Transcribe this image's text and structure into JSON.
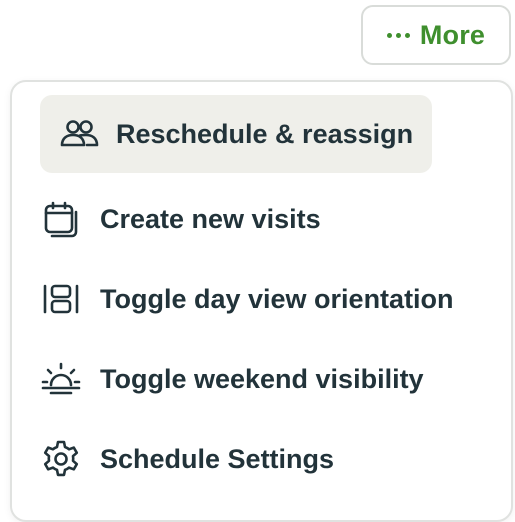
{
  "more_button": {
    "label": "More",
    "icon": "ellipsis-icon",
    "accent_color": "#3f8f2e"
  },
  "menu": {
    "items": [
      {
        "label": "Reschedule & reassign",
        "icon": "users-icon",
        "highlighted": true
      },
      {
        "label": "Create new visits",
        "icon": "calendar-icon",
        "highlighted": false
      },
      {
        "label": "Toggle day view orientation",
        "icon": "layout-icon",
        "highlighted": false
      },
      {
        "label": "Toggle weekend visibility",
        "icon": "sunrise-icon",
        "highlighted": false
      },
      {
        "label": "Schedule Settings",
        "icon": "gear-icon",
        "highlighted": false
      }
    ]
  }
}
